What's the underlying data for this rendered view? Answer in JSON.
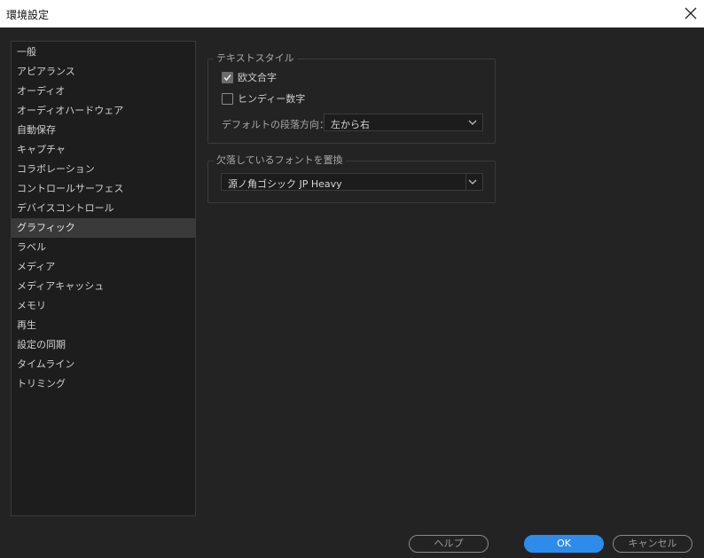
{
  "window": {
    "title": "環境設定"
  },
  "sidebar": {
    "selected_index": 9,
    "items": [
      {
        "label": "一般"
      },
      {
        "label": "アピアランス"
      },
      {
        "label": "オーディオ"
      },
      {
        "label": "オーディオハードウェア"
      },
      {
        "label": "自動保存"
      },
      {
        "label": "キャプチャ"
      },
      {
        "label": "コラボレーション"
      },
      {
        "label": "コントロールサーフェス"
      },
      {
        "label": "デバイスコントロール"
      },
      {
        "label": "グラフィック"
      },
      {
        "label": "ラベル"
      },
      {
        "label": "メディア"
      },
      {
        "label": "メディアキャッシュ"
      },
      {
        "label": "メモリ"
      },
      {
        "label": "再生"
      },
      {
        "label": "設定の同期"
      },
      {
        "label": "タイムライン"
      },
      {
        "label": "トリミング"
      }
    ]
  },
  "text_style": {
    "title": "テキストスタイル",
    "latin_composition": {
      "label": "欧文合字",
      "checked": true
    },
    "hindi_digits": {
      "label": "ヒンディー数字",
      "checked": false
    },
    "paragraph_direction": {
      "label": "デフォルトの段落方向：",
      "value": "左から右"
    }
  },
  "missing_fonts": {
    "title": "欠落しているフォントを置換",
    "font": {
      "value": "源ノ角ゴシック JP Heavy"
    }
  },
  "footer": {
    "help_label": "ヘルプ",
    "ok_label": "OK",
    "cancel_label": "キャンセル"
  },
  "colors": {
    "background": "#232323",
    "accent": "#2d8ceb",
    "selected_item": "#3a3a3a"
  }
}
